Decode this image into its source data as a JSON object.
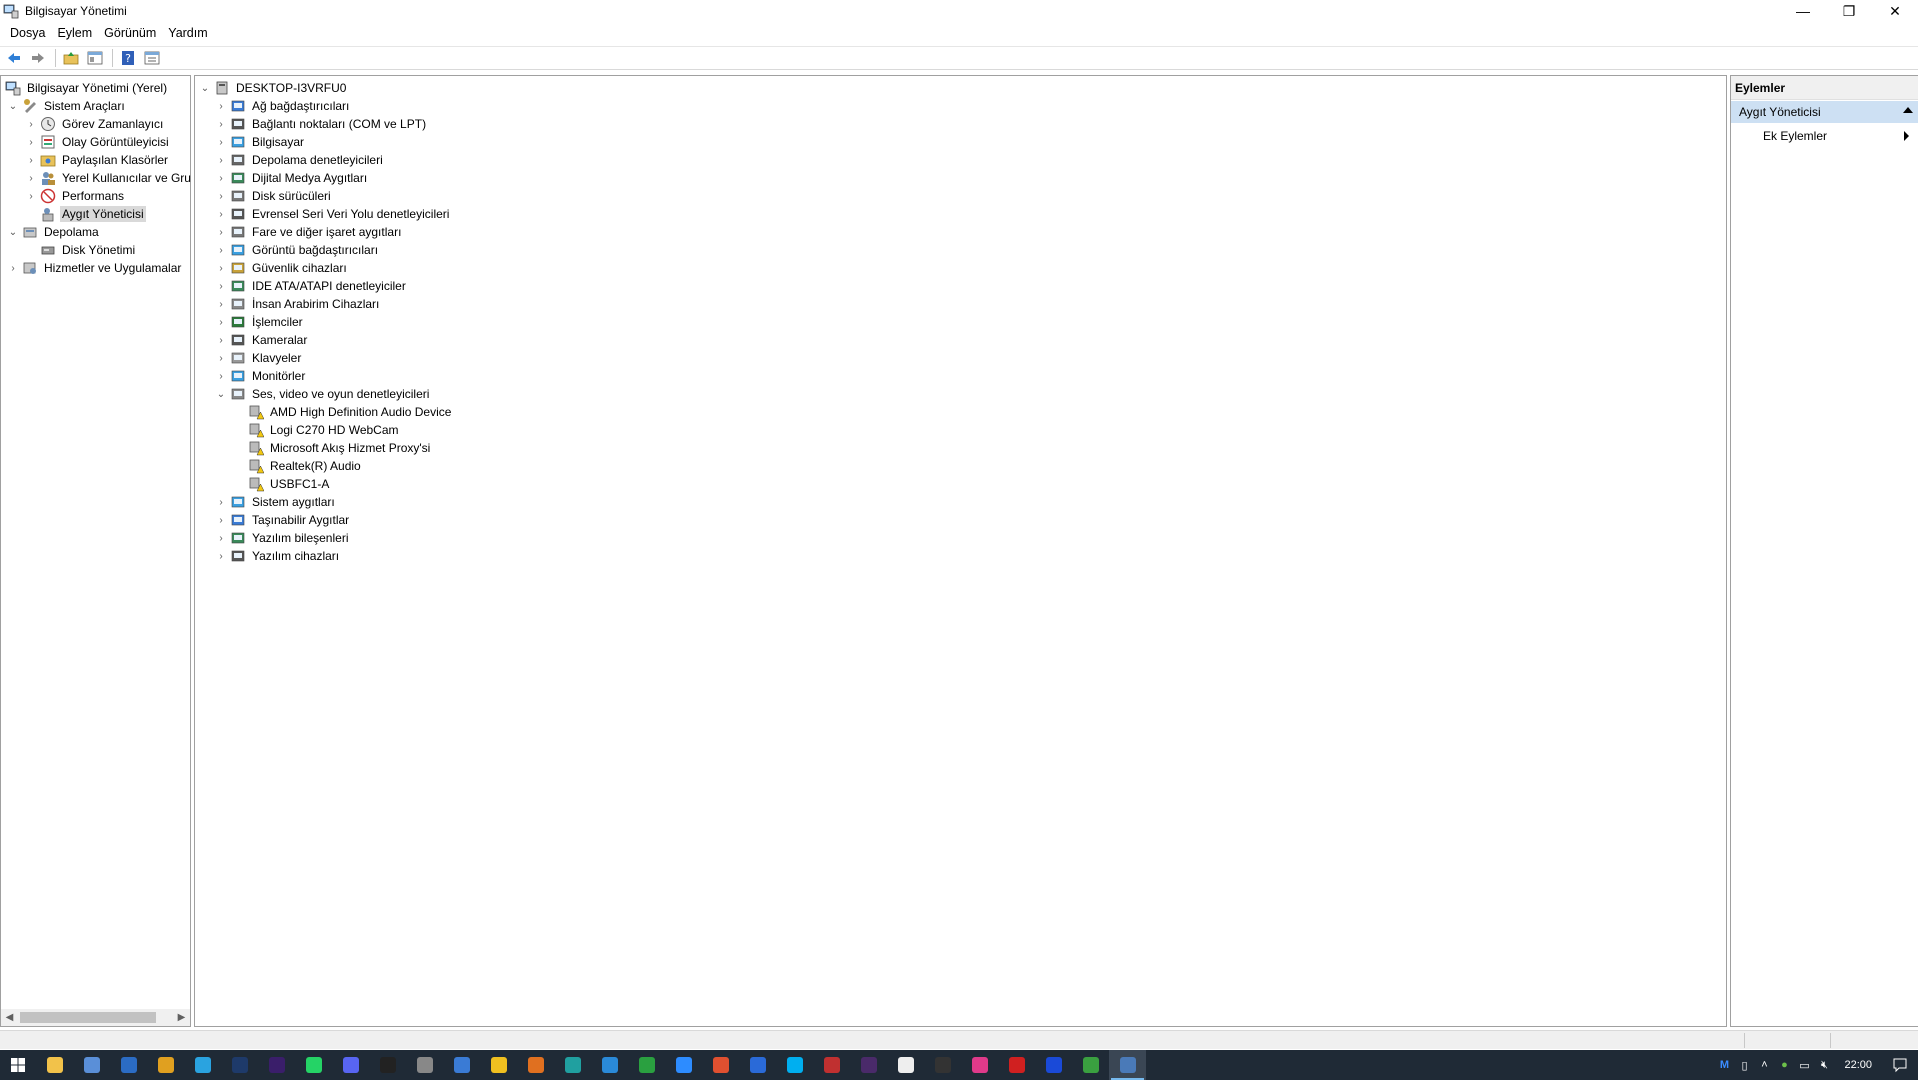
{
  "window": {
    "title": "Bilgisayar Yönetimi",
    "controls": {
      "minimize": "—",
      "restore": "❐",
      "close": "✕"
    }
  },
  "menu": [
    "Dosya",
    "Eylem",
    "Görünüm",
    "Yardım"
  ],
  "toolbar": {
    "icons": [
      "back-arrow-icon",
      "forward-arrow-icon",
      "up-folder-icon",
      "show-hide-tree-icon",
      "help-icon",
      "properties-icon"
    ]
  },
  "left_tree": {
    "root": "Bilgisayar Yönetimi (Yerel)",
    "system_tools": "Sistem Araçları",
    "system_items": [
      "Görev Zamanlayıcı",
      "Olay Görüntüleyicisi",
      "Paylaşılan Klasörler",
      "Yerel Kullanıcılar ve Gru",
      "Performans",
      "Aygıt Yöneticisi"
    ],
    "storage": "Depolama",
    "storage_items": [
      "Disk Yönetimi"
    ],
    "services": "Hizmetler ve Uygulamalar"
  },
  "device_tree": {
    "computer": "DESKTOP-I3VRFU0",
    "categories": [
      "Ağ bağdaştırıcıları",
      "Bağlantı noktaları (COM ve LPT)",
      "Bilgisayar",
      "Depolama denetleyicileri",
      "Dijital Medya Aygıtları",
      "Disk sürücüleri",
      "Evrensel Seri Veri Yolu denetleyicileri",
      "Fare ve diğer işaret aygıtları",
      "Görüntü bağdaştırıcıları",
      "Güvenlik cihazları",
      "IDE ATA/ATAPI denetleyiciler",
      "İnsan Arabirim Cihazları",
      "İşlemciler",
      "Kameralar",
      "Klavyeler",
      "Monitörler",
      "Ses, video ve oyun denetleyicileri"
    ],
    "audio_devices": [
      "AMD High Definition Audio Device",
      "Logi C270 HD WebCam",
      "Microsoft Akış Hizmet Proxy'si",
      "Realtek(R) Audio",
      "USBFC1-A"
    ],
    "categories_after": [
      "Sistem aygıtları",
      "Taşınabilir Aygıtlar",
      "Yazılım bileşenleri",
      "Yazılım cihazları"
    ]
  },
  "actions": {
    "header": "Eylemler",
    "group": "Aygıt Yöneticisi",
    "item": "Ek Eylemler"
  },
  "taskbar": {
    "apps": [
      "file-explorer",
      "calculator",
      "outlook",
      "chrome",
      "telegram",
      "photoshop",
      "after-effects",
      "whatsapp",
      "discord",
      "app-black",
      "app-circle",
      "app-blue",
      "notes",
      "app-orange",
      "app-teal",
      "vscode",
      "app-green",
      "zoom",
      "app-red",
      "app-window",
      "app-skype",
      "app-grid",
      "app-ae",
      "chatgpt",
      "app-dark",
      "app-pink",
      "app-red2",
      "app-blue2",
      "app-green2",
      "computer-management"
    ],
    "clock": "22:00"
  },
  "colors": {
    "selection": "#cde0f3",
    "taskbar": "#1f2a36",
    "warning": "#f2c811"
  }
}
